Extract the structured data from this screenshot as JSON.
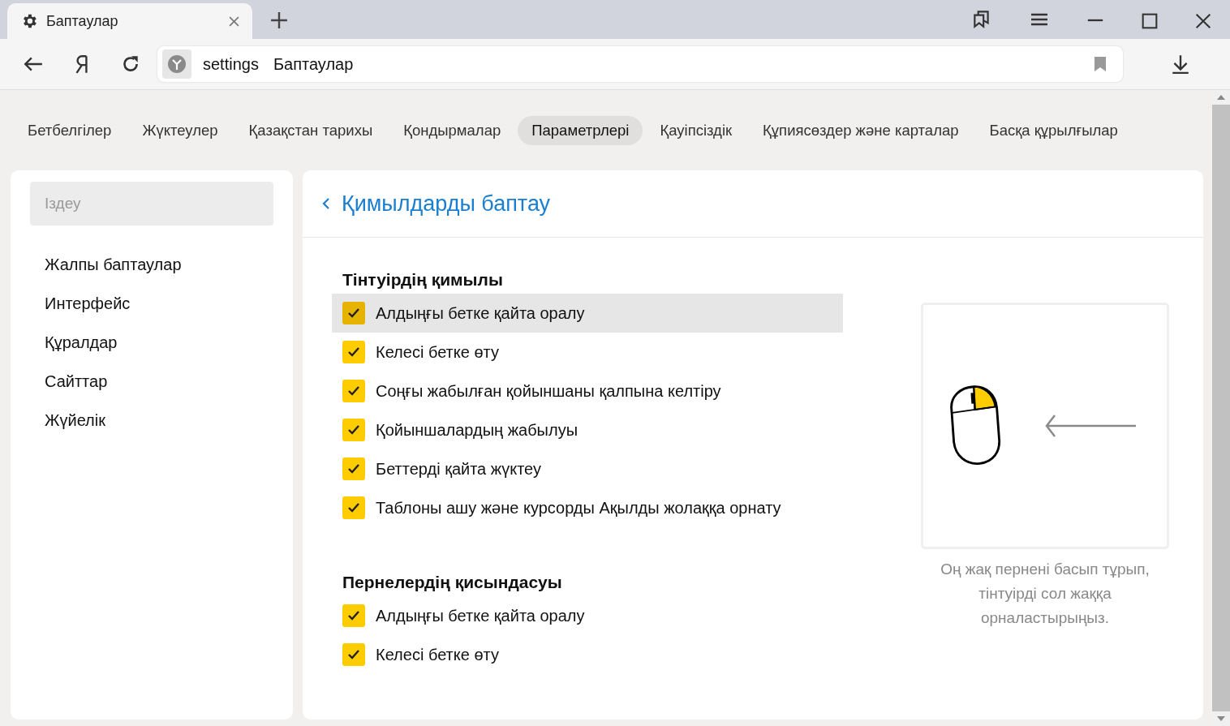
{
  "browser_tab": {
    "title": "Баптаулар"
  },
  "address_bar": {
    "scheme": "settings",
    "page": "Баптаулар"
  },
  "nav_tabs": [
    {
      "label": "Бетбелгілер",
      "selected": false
    },
    {
      "label": "Жүктеулер",
      "selected": false
    },
    {
      "label": "Қазақстан тарихы",
      "selected": false
    },
    {
      "label": "Қондырмалар",
      "selected": false
    },
    {
      "label": "Параметрлері",
      "selected": true
    },
    {
      "label": "Қауіпсіздік",
      "selected": false
    },
    {
      "label": "Құпиясөздер және карталар",
      "selected": false
    },
    {
      "label": "Басқа құрылғылар",
      "selected": false
    }
  ],
  "sidebar": {
    "search": {
      "placeholder": "Іздеу"
    },
    "items": [
      {
        "label": "Жалпы баптаулар"
      },
      {
        "label": "Интерфейс"
      },
      {
        "label": "Құралдар"
      },
      {
        "label": "Сайттар"
      },
      {
        "label": "Жүйелік"
      }
    ]
  },
  "panel": {
    "title": "Қимылдарды баптау",
    "sections": [
      {
        "heading": "Тінтуірдің қимылы",
        "options": [
          {
            "label": "Алдыңғы бетке қайта оралу",
            "checked": true,
            "selected": true
          },
          {
            "label": "Келесі бетке өту",
            "checked": true,
            "selected": false
          },
          {
            "label": "Соңғы жабылған қойыншаны қалпына келтіру",
            "checked": true,
            "selected": false
          },
          {
            "label": "Қойыншалардың жабылуы",
            "checked": true,
            "selected": false
          },
          {
            "label": "Беттерді қайта жүктеу",
            "checked": true,
            "selected": false
          },
          {
            "label": "Таблоны ашу және курсорды Ақылды жолаққа орнату",
            "checked": true,
            "selected": false
          }
        ]
      },
      {
        "heading": "Пернелердің қисындасуы",
        "options": [
          {
            "label": "Алдыңғы бетке қайта оралу",
            "checked": true,
            "selected": false
          },
          {
            "label": "Келесі бетке өту",
            "checked": true,
            "selected": false
          }
        ]
      }
    ],
    "hint": "Оң жақ пернені басып тұрып, тінтуірді сол жаққа орналастырыңыз."
  }
}
